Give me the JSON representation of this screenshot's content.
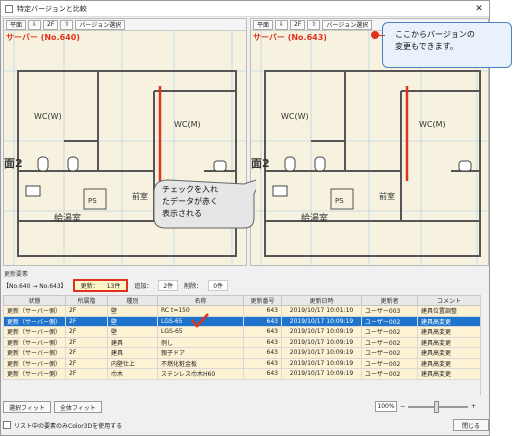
{
  "window": {
    "title": "特定バージョンと比較",
    "close_glyph": "✕"
  },
  "left_pane": {
    "toolbar": {
      "plan_label": "平面",
      "floor_label": "2F",
      "version_label": "バージョン選択"
    },
    "title": "サーバー (No.640)"
  },
  "right_pane": {
    "toolbar": {
      "plan_label": "平面",
      "floor_label": "2F",
      "version_label": "バージョン選択"
    },
    "title": "サーバー (No.643)"
  },
  "floorplan": {
    "rooms": {
      "wc_w": "WC(W)",
      "wc_m": "WC(M)",
      "ps": "PS",
      "zenshitsu": "前室",
      "kyutoshitsu": "給湯室",
      "floor_mark": "面2"
    }
  },
  "callouts": {
    "version_change": [
      "ここからバージョンの",
      "変更もできます。"
    ],
    "checked_red": [
      "チェックを入れ",
      "たデータが赤く",
      "表示される"
    ]
  },
  "summary": {
    "section_label": "更新要素",
    "compare_label": "【No.640 → No.643】",
    "updated_label": "更新：",
    "updated_count": "13件",
    "added_label": "追加：",
    "added_count": "2件",
    "deleted_label": "削除：",
    "deleted_count": "0件"
  },
  "table": {
    "columns": [
      "状態",
      "所属階",
      "種別",
      "名称",
      "更新番号",
      "更新日時",
      "更新者",
      "コメント"
    ],
    "rows": [
      [
        "更新（サーバー側）",
        "2F",
        "壁",
        "RC t=150",
        "643",
        "2019/10/17 10:01:10",
        "ユーザー003",
        "建具位置調整"
      ],
      [
        "更新（サーバー側）",
        "2F",
        "壁",
        "LGS-65",
        "643",
        "2019/10/17 10:09:19",
        "ユーザー002",
        "建具高変更"
      ],
      [
        "更新（サーバー側）",
        "2F",
        "壁",
        "LGS-65",
        "643",
        "2019/10/17 10:09:19",
        "ユーザー002",
        "建具高変更"
      ],
      [
        "更新（サーバー側）",
        "2F",
        "建具",
        "例し",
        "643",
        "2019/10/17 10:09:19",
        "ユーザー002",
        "建具高変更"
      ],
      [
        "更新（サーバー側）",
        "2F",
        "建具",
        "親子ドア",
        "643",
        "2019/10/17 10:09:19",
        "ユーザー002",
        "建具高変更"
      ],
      [
        "更新（サーバー側）",
        "2F",
        "内壁仕上",
        "不燃化粧金板",
        "643",
        "2019/10/17 10:09:19",
        "ユーザー002",
        "建具高変更"
      ],
      [
        "更新（サーバー側）",
        "2F",
        "巾木",
        "ステンレス巾木H60",
        "643",
        "2019/10/17 10:09:19",
        "ユーザー002",
        "建具高変更"
      ]
    ],
    "selected_row": 1
  },
  "footer": {
    "fit_selected": "選択フィット",
    "fit_all": "全体フィット",
    "zoom": "100%",
    "zoom_minus": "−",
    "zoom_plus": "+",
    "checkbox_label": "リスト中の要素のみColor3Dを使用する",
    "close": "閉じる"
  },
  "colors": {
    "accent_red": "#e0331f",
    "selection_blue": "#1e73cc",
    "row_bg": "#fdf3d4",
    "callout_border": "#4a7fc1"
  }
}
